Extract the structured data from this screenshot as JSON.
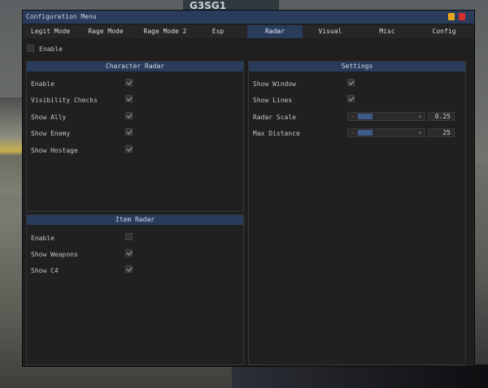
{
  "background": {
    "sign_text": "G3SG1"
  },
  "window": {
    "title": "Configuration Menu"
  },
  "tabs": [
    {
      "label": "Legit Mode",
      "active": false
    },
    {
      "label": "Rage Mode",
      "active": false
    },
    {
      "label": "Rage Mode 2",
      "active": false
    },
    {
      "label": "Esp",
      "active": false
    },
    {
      "label": "Radar",
      "active": true
    },
    {
      "label": "Visual",
      "active": false
    },
    {
      "label": "Misc",
      "active": false
    },
    {
      "label": "Config",
      "active": false
    }
  ],
  "top": {
    "enable_label": "Enable",
    "enable_checked": false
  },
  "character_radar": {
    "title": "Character Radar",
    "items": [
      {
        "label": "Enable",
        "checked": true
      },
      {
        "label": "Visibility Checks",
        "checked": true
      },
      {
        "label": "Show Ally",
        "checked": true
      },
      {
        "label": "Show Enemy",
        "checked": true
      },
      {
        "label": "Show Hostage",
        "checked": true
      }
    ]
  },
  "item_radar": {
    "title": "Item Radar",
    "items": [
      {
        "label": "Enable",
        "checked": false
      },
      {
        "label": "Show Weapons",
        "checked": true
      },
      {
        "label": "Show C4",
        "checked": true
      }
    ]
  },
  "settings": {
    "title": "Settings",
    "show_window": {
      "label": "Show Window",
      "checked": true
    },
    "show_lines": {
      "label": "Show Lines",
      "checked": true
    },
    "radar_scale": {
      "label": "Radar Scale",
      "value": "0.25",
      "dec": "-",
      "inc": "+",
      "fraction": 0.25
    },
    "max_distance": {
      "label": "Max Distance",
      "value": "25",
      "dec": "-",
      "inc": "+",
      "fraction": 0.25
    }
  },
  "colors": {
    "accent": "#2a3c5c",
    "slider_fill": "#3f5b8a",
    "minimize": "#e8a520",
    "close": "#d62d2d"
  }
}
